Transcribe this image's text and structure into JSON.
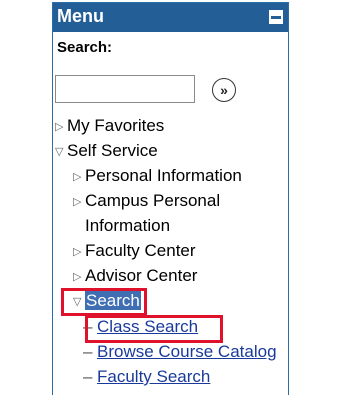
{
  "menu": {
    "title": "Menu",
    "search_label": "Search:",
    "search_value": "",
    "go_label": "»"
  },
  "tree": {
    "my_favorites": "My Favorites",
    "self_service": "Self Service",
    "personal_information": "Personal Information",
    "campus_personal_line1": "Campus Personal",
    "campus_personal_line2": "Information",
    "faculty_center": "Faculty Center",
    "advisor_center": "Advisor Center",
    "search": "Search",
    "class_search": "Class Search",
    "browse_course_catalog": "Browse Course Catalog",
    "faculty_search": "Faculty Search"
  },
  "icons": {
    "collapsed": "triangle-right-icon",
    "expanded": "triangle-down-icon",
    "collapse_menu": "minus-icon",
    "go": "double-chevron-right-icon"
  },
  "colors": {
    "header_bg": "#235f96",
    "link": "#1a3a9b",
    "highlight": "#e0112b",
    "selection": "#3f6fb2"
  }
}
